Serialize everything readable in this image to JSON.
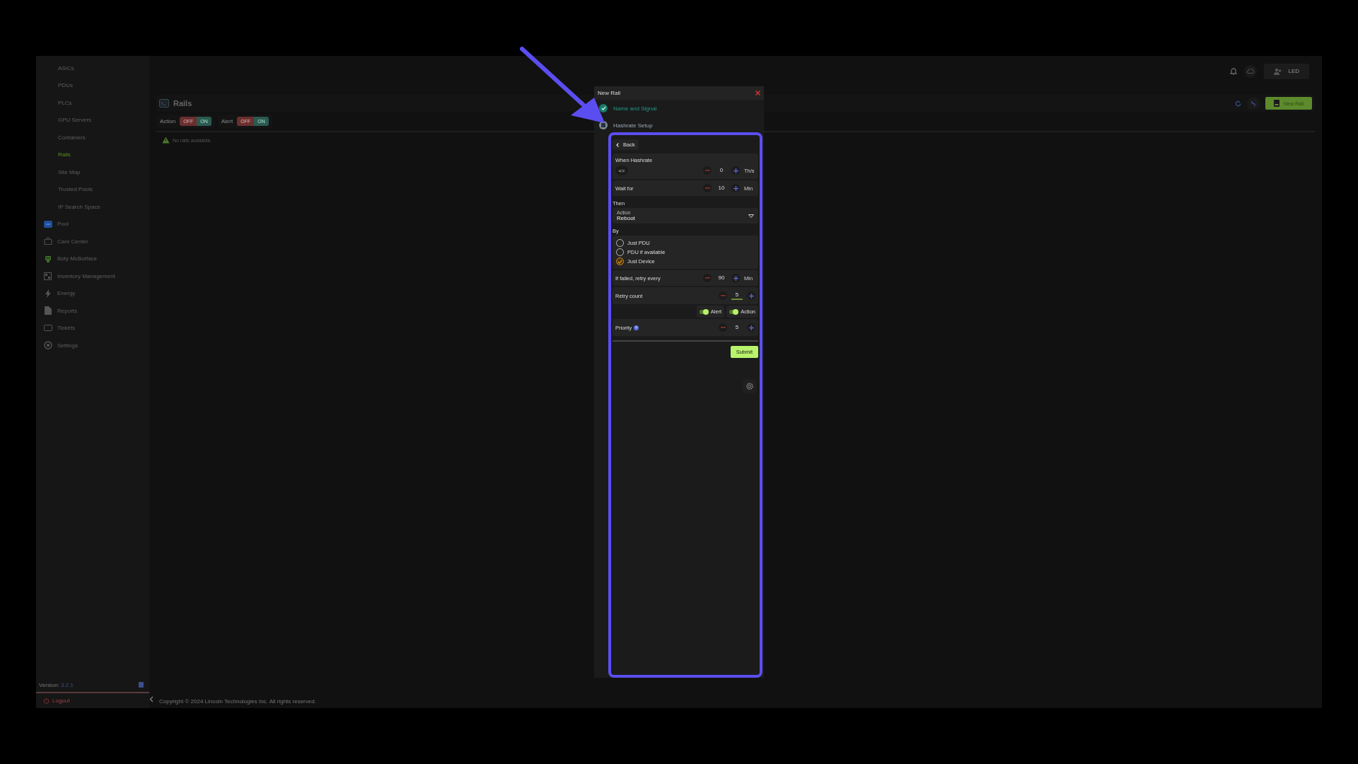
{
  "sidebar": {
    "items": [
      {
        "label": "ASICs",
        "kind": "sub",
        "selected": false
      },
      {
        "label": "PDUs",
        "kind": "sub",
        "selected": false
      },
      {
        "label": "PLCs",
        "kind": "sub",
        "selected": false
      },
      {
        "label": "GPU Servers",
        "kind": "sub",
        "selected": false
      },
      {
        "label": "Containers",
        "kind": "sub",
        "selected": false
      },
      {
        "label": "Rails",
        "kind": "sub",
        "selected": true
      },
      {
        "label": "Site Map",
        "kind": "sub",
        "selected": false
      },
      {
        "label": "Trusted Pools",
        "kind": "sub",
        "selected": false
      },
      {
        "label": "IP Search Space",
        "kind": "sub",
        "selected": false
      },
      {
        "label": "Pool",
        "kind": "pool",
        "selected": false
      },
      {
        "label": "Care Center",
        "kind": "care",
        "selected": false
      },
      {
        "label": "Boty McBotface",
        "kind": "bot",
        "selected": false
      },
      {
        "label": "Inventory Management",
        "kind": "inventory",
        "selected": false
      },
      {
        "label": "Energy",
        "kind": "energy",
        "selected": false
      },
      {
        "label": "Reports",
        "kind": "reports",
        "selected": false
      },
      {
        "label": "Tickets",
        "kind": "tickets",
        "selected": false
      },
      {
        "label": "Settings",
        "kind": "settings",
        "selected": false
      }
    ],
    "version_label": "Version:",
    "version": "3.2.1",
    "logout": "Logout"
  },
  "topbar": {
    "user_button": "LED"
  },
  "page": {
    "title": "Rails",
    "filters": [
      {
        "label": "Action",
        "off": "OFF",
        "on": "ON"
      },
      {
        "label": "Alert",
        "off": "OFF",
        "on": "ON"
      }
    ],
    "new_button": "New Rail",
    "empty_message": "No rails available."
  },
  "footer": "Copyright © 2024 Lincoln Technologies Inc. All rights reserved.",
  "modal": {
    "title": "New Rail",
    "steps": [
      {
        "label": "Name and Signal",
        "done": true
      },
      {
        "label": "Hashrate Setup",
        "done": false
      }
    ],
    "back": "Back",
    "condition": {
      "label": "When Hashrate",
      "operator": "<=",
      "value": "0",
      "unit": "Th/s"
    },
    "wait": {
      "label": "Wait for",
      "value": "10",
      "unit": "Min"
    },
    "then_label": "Then",
    "action_select": {
      "label": "Action",
      "value": "Reboot"
    },
    "by_label": "By",
    "by_options": [
      {
        "label": "Just PDU",
        "selected": false
      },
      {
        "label": "PDU if available",
        "selected": false
      },
      {
        "label": "Just Device",
        "selected": true
      }
    ],
    "retry_every": {
      "label": "If failed, retry every",
      "value": "90",
      "unit": "Min"
    },
    "retry_count": {
      "label": "Retry count",
      "value": "5",
      "focused": true
    },
    "toggles": [
      {
        "label": "Alert",
        "on": true
      },
      {
        "label": "Action",
        "on": true
      }
    ],
    "priority": {
      "label": "Priority",
      "value": "5"
    },
    "submit": "Submit"
  }
}
